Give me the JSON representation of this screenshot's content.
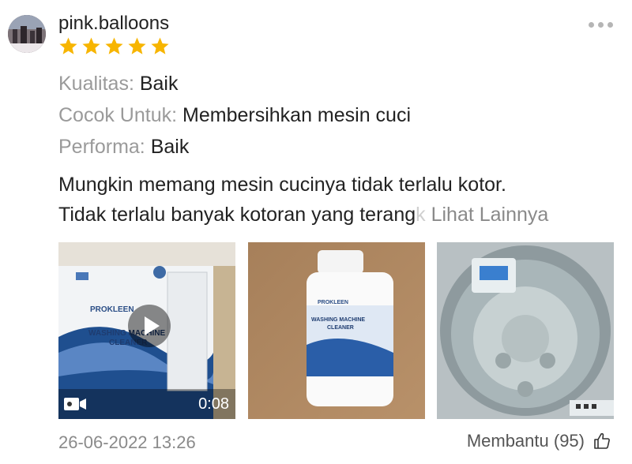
{
  "user": {
    "name": "pink.balloons",
    "rating": 5,
    "star_color": "#f7b500"
  },
  "attributes": [
    {
      "key": "Kualitas:",
      "value": "Baik"
    },
    {
      "key": "Cocok Untuk:",
      "value": "Membersihkan mesin cuci"
    },
    {
      "key": "Performa:",
      "value": "Baik"
    }
  ],
  "review": {
    "line1": "Mungkin memang mesin cucinya tidak terlalu kotor.",
    "line2_visible": "Tidak terlalu banyak kotoran yang terang",
    "line2_faded": "k",
    "more_label": "Lihat Lainnya"
  },
  "media": {
    "video_duration": "0:08",
    "product_name_line1": "WASHING MACHINE",
    "product_name_line2": "CLEANER",
    "brand": "PROKLEEN"
  },
  "footer": {
    "date": "26-06-2022 13:26",
    "helpful_label": "Membantu (95)"
  }
}
